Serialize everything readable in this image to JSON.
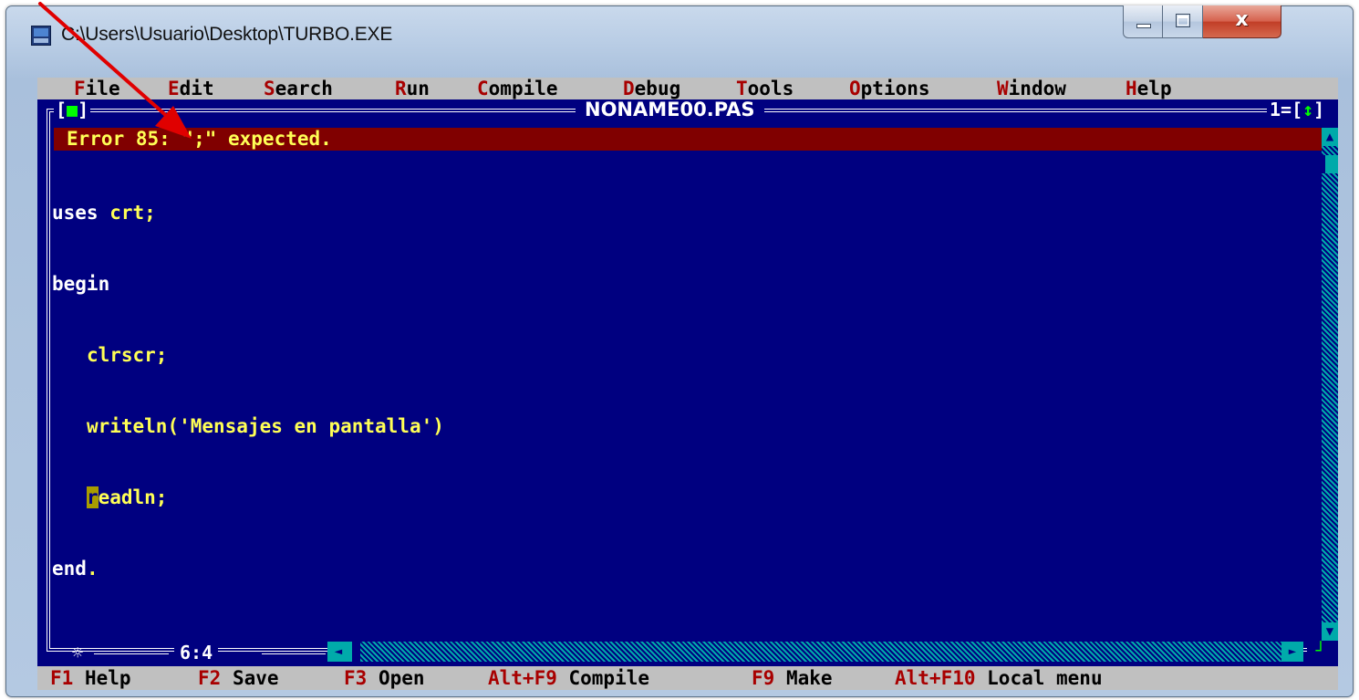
{
  "window": {
    "title": "C:\\Users\\Usuario\\Desktop\\TURBO.EXE"
  },
  "menu": [
    {
      "hot": "F",
      "rest": "ile"
    },
    {
      "hot": "E",
      "rest": "dit"
    },
    {
      "hot": "S",
      "rest": "earch"
    },
    {
      "hot": "R",
      "rest": "un"
    },
    {
      "hot": "C",
      "rest": "ompile"
    },
    {
      "hot": "D",
      "rest": "ebug"
    },
    {
      "hot": "T",
      "rest": "ools"
    },
    {
      "hot": "O",
      "rest": "ptions"
    },
    {
      "hot": "W",
      "rest": "indow"
    },
    {
      "hot": "H",
      "rest": "elp"
    }
  ],
  "editor": {
    "close_box_left": "[",
    "close_box_square": "■",
    "close_box_right": "]",
    "filename": "NONAME00.PAS",
    "window_number": "1=[",
    "zoom_arrow": "↕",
    "window_number_close": "]",
    "error": "Error 85: \";\" expected.",
    "code": {
      "l1_kw": "uses ",
      "l1_tx": "crt;",
      "l2_kw": "begin",
      "l3_indent": "   ",
      "l3_tx": "clrscr;",
      "l4_indent": "   ",
      "l4_tx": "writeln('Mensajes en pantalla')",
      "l5_indent": "   ",
      "l5_cursor": "r",
      "l5_tx": "eadln;",
      "l6_kw": "end",
      "l6_tx": "."
    },
    "position": "6:4",
    "star": "☼"
  },
  "scrollbars": {
    "up_arrow": "▲",
    "down_arrow": "▼",
    "left_arrow": "◄",
    "right_arrow": "►",
    "resize_glyph": "┘"
  },
  "statusbar": [
    {
      "key": "F1",
      "label": " Help"
    },
    {
      "key": "F2",
      "label": " Save"
    },
    {
      "key": "F3",
      "label": " Open"
    },
    {
      "key": "Alt+F9",
      "label": " Compile"
    },
    {
      "key": "F9",
      "label": " Make"
    },
    {
      "key": "Alt+F10",
      "label": " Local menu"
    }
  ],
  "colors": {
    "background": "#000080",
    "menu_bg": "#c0c0c0",
    "hotkey": "#a80000",
    "code_text": "#ffff55",
    "error_bg": "#800000",
    "annotation": "#e00000"
  },
  "icons": {
    "app": "dos-app-icon",
    "minimize": "minimize-icon",
    "maximize": "maximize-icon",
    "close": "close-icon",
    "annotation": "red-arrow-icon"
  }
}
